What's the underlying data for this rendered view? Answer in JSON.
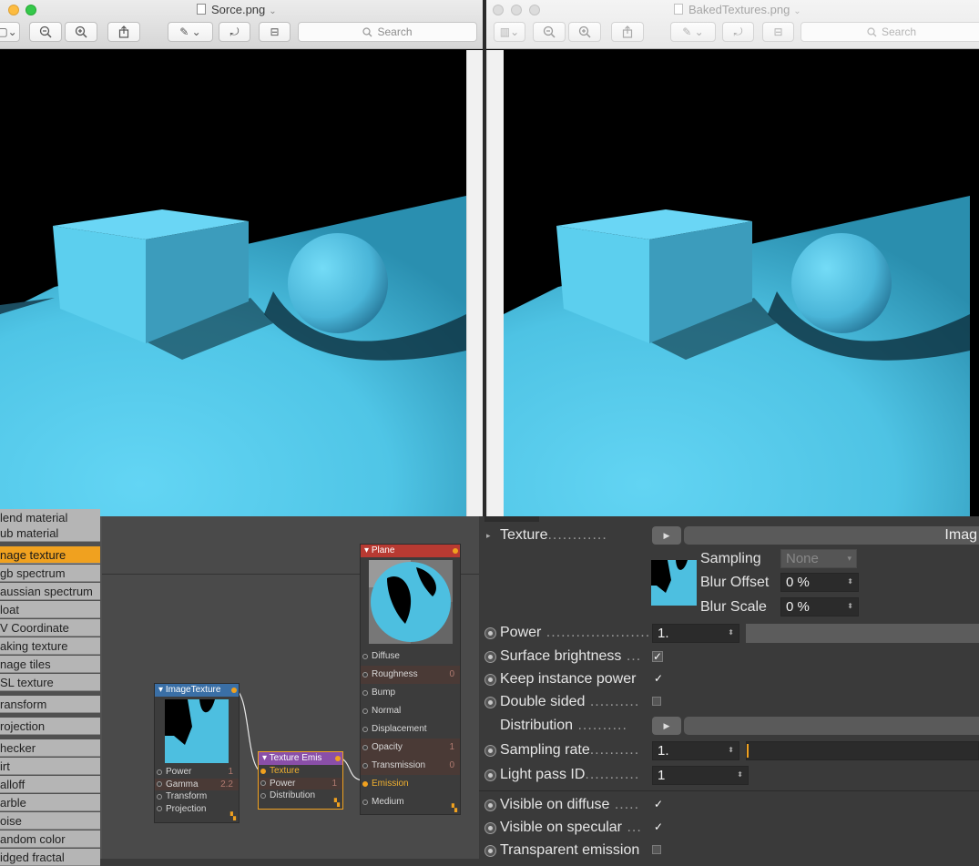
{
  "window_left": {
    "title": "Sorce.png",
    "search_placeholder": "Search"
  },
  "window_right": {
    "title": "BakedTextures.png",
    "search_placeholder": "Search"
  },
  "material_list": {
    "items": [
      {
        "label": "lend material",
        "active": false
      },
      {
        "label": "ub material",
        "active": false
      },
      {
        "label": "nage texture",
        "active": true
      },
      {
        "label": "gb spectrum",
        "active": false
      },
      {
        "label": "aussian spectrum",
        "active": false
      },
      {
        "label": "loat",
        "active": false
      },
      {
        "label": "V Coordinate",
        "active": false
      },
      {
        "label": "aking texture",
        "active": false
      },
      {
        "label": "nage tiles",
        "active": false
      },
      {
        "label": "SL texture",
        "active": false
      },
      {
        "label": "ransform",
        "active": false
      },
      {
        "label": "rojection",
        "active": false
      },
      {
        "label": "hecker",
        "active": false
      },
      {
        "label": "irt",
        "active": false
      },
      {
        "label": "alloff",
        "active": false
      },
      {
        "label": "arble",
        "active": false
      },
      {
        "label": "oise",
        "active": false
      },
      {
        "label": "andom color",
        "active": false
      },
      {
        "label": "idged fractal",
        "active": false
      }
    ]
  },
  "nodes": {
    "plane": {
      "title": "Plane",
      "inputs": [
        {
          "label": "Diffuse",
          "value": ""
        },
        {
          "label": "Roughness",
          "value": "0"
        },
        {
          "label": "Bump",
          "value": ""
        },
        {
          "label": "Normal",
          "value": ""
        },
        {
          "label": "Displacement",
          "value": ""
        },
        {
          "label": "Opacity",
          "value": "1"
        },
        {
          "label": "Transmission",
          "value": "0"
        },
        {
          "label": "Emission",
          "value": ""
        },
        {
          "label": "Medium",
          "value": ""
        }
      ]
    },
    "image_texture": {
      "title": "ImageTexture",
      "inputs": [
        {
          "label": "Power",
          "value": "1"
        },
        {
          "label": "Gamma",
          "value": "2.2"
        },
        {
          "label": "Transform",
          "value": ""
        },
        {
          "label": "Projection",
          "value": ""
        }
      ]
    },
    "texture_emission": {
      "title": "Texture Emis",
      "inputs": [
        {
          "label": "Texture",
          "value": ""
        },
        {
          "label": "Power",
          "value": "1"
        },
        {
          "label": "Distribution",
          "value": ""
        }
      ]
    }
  },
  "attributes": {
    "texture_label": "Texture",
    "texture_field": "Imag",
    "sampling_label": "Sampling",
    "sampling_value": "None",
    "blur_offset_label": "Blur Offset",
    "blur_offset_value": "0 %",
    "blur_scale_label": "Blur Scale",
    "blur_scale_value": "0 %",
    "power_label": "Power",
    "power_value": "1.",
    "surface_brightness_label": "Surface brightness",
    "keep_instance_power_label": "Keep instance power",
    "double_sided_label": "Double sided",
    "distribution_label": "Distribution",
    "sampling_rate_label": "Sampling rate",
    "sampling_rate_value": "1.",
    "light_pass_id_label": "Light pass ID",
    "light_pass_id_value": "1",
    "visible_diffuse_label": "Visible on diffuse",
    "visible_specular_label": "Visible on specular",
    "transparent_emission_label": "Transparent emission",
    "checkmark": "✓"
  },
  "colors": {
    "accent": "#f0a11f",
    "scene_blue": "#5fcfef",
    "plane_header": "#b83a32",
    "image_texture_header": "#3a6fa6",
    "texture_emission_header": "#8a4fa8"
  }
}
